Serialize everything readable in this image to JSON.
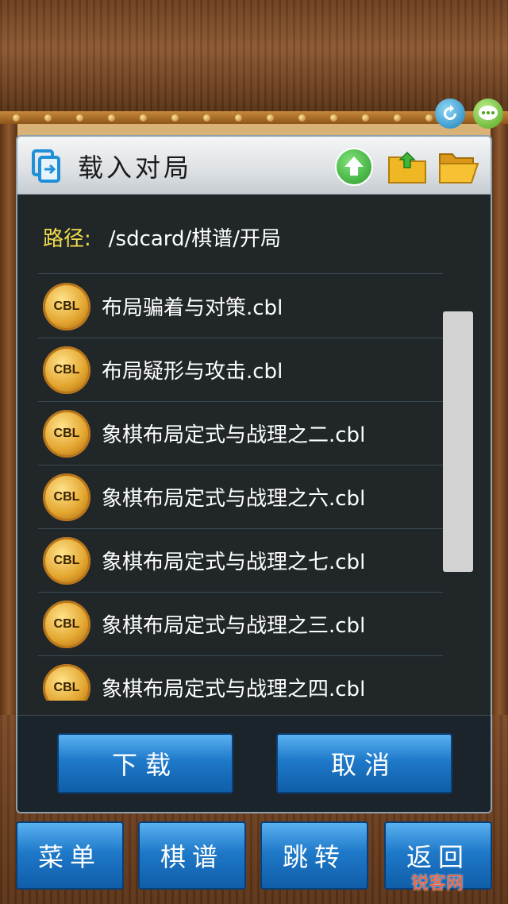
{
  "dialog": {
    "title": "载入对局",
    "path_label": "路径:",
    "path_value": "/sdcard/棋谱/开局",
    "files": [
      {
        "icon_text": "CBL",
        "name": "布局骗着与对策.cbl"
      },
      {
        "icon_text": "CBL",
        "name": "布局疑形与攻击.cbl"
      },
      {
        "icon_text": "CBL",
        "name": "象棋布局定式与战理之二.cbl"
      },
      {
        "icon_text": "CBL",
        "name": "象棋布局定式与战理之六.cbl"
      },
      {
        "icon_text": "CBL",
        "name": "象棋布局定式与战理之七.cbl"
      },
      {
        "icon_text": "CBL",
        "name": "象棋布局定式与战理之三.cbl"
      },
      {
        "icon_text": "CBL",
        "name": "象棋布局定式与战理之四.cbl"
      }
    ],
    "download_label": "下载",
    "cancel_label": "取消"
  },
  "bottom_bar": {
    "menu_label": "菜单",
    "manual_label": "棋谱",
    "jump_label": "跳转",
    "back_label": "返回"
  },
  "watermark": "锐客网",
  "icons": {
    "dialog": "file-load-icon",
    "home": "home-icon",
    "folder_up": "folder-up-icon",
    "folder_open": "folder-open-icon",
    "refresh": "refresh-icon",
    "chat": "chat-icon"
  },
  "colors": {
    "path_label": "#f1dc4c",
    "button_blue": "#1e79c9",
    "dialog_bg": "#121c24"
  }
}
